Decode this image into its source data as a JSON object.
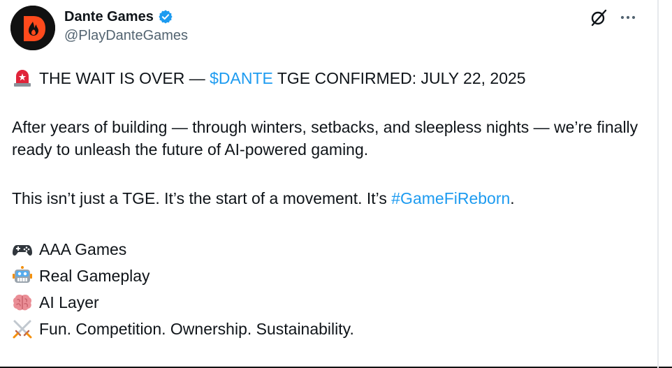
{
  "author": {
    "display_name": "Dante Games",
    "handle": "@PlayDanteGames",
    "avatar_letter": "D",
    "avatar_bg": "#111111",
    "avatar_accent": "#ff4a1c",
    "verified_color": "#1d9bf0"
  },
  "actions": {
    "grok_icon": "grok-icon",
    "more_label": "···"
  },
  "post": {
    "line1_emoji": "siren",
    "line1_before": "THE WAIT IS OVER — ",
    "line1_cashtag": "$DANTE",
    "line1_after": " TGE CONFIRMED: JULY 22, 2025",
    "para2": "After years of building — through winters, setbacks, and sleepless nights — we’re finally ready to unleash the future of AI-powered gaming.",
    "para3_before": "This isn’t just a TGE. It’s the start of a movement. It’s ",
    "para3_hashtag": "#GameFiReborn",
    "para3_after": ".",
    "list": [
      {
        "emoji": "game-controller",
        "text": "AAA Games"
      },
      {
        "emoji": "robot",
        "text": "Real Gameplay"
      },
      {
        "emoji": "brain",
        "text": "AI Layer"
      },
      {
        "emoji": "crossed-swords",
        "text": "Fun. Competition. Ownership. Sustainability."
      }
    ]
  },
  "colors": {
    "text": "#0f1419",
    "secondary": "#536471",
    "link": "#1d9bf0"
  }
}
